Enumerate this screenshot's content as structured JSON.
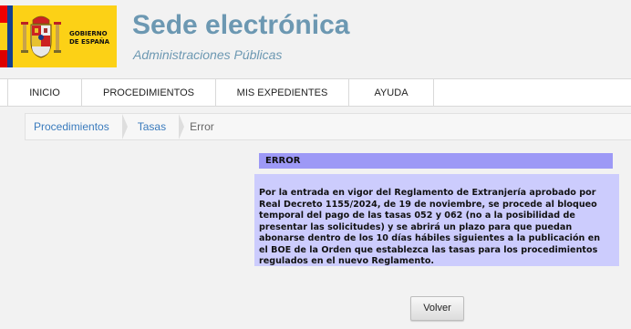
{
  "header": {
    "logo_text_line1": "GOBIERNO",
    "logo_text_line2": "DE ESPAÑA",
    "title": "Sede electrónica",
    "subtitle": "Administraciones Públicas"
  },
  "nav": {
    "items": [
      {
        "label": "INICIO"
      },
      {
        "label": "PROCEDIMIENTOS"
      },
      {
        "label": "MIS EXPEDIENTES"
      },
      {
        "label": "AYUDA"
      }
    ]
  },
  "breadcrumb": {
    "items": [
      {
        "label": "Procedimientos"
      },
      {
        "label": "Tasas"
      },
      {
        "label": "Error"
      }
    ]
  },
  "error": {
    "heading": "ERROR",
    "message": "Por la entrada en vigor del Reglamento de Extranjería aprobado por Real Decreto 1155/2024, de 19 de noviembre, se procede al bloqueo temporal del pago de las tasas 052 y 062 (no a la posibilidad de presentar las solicitudes) y se abrirá un plazo para que puedan abonarse dentro de los 10 días hábiles siguientes a la publicación en el BOE de la Orden que establezca las tasas para los procedimientos regulados en el nuevo Reglamento."
  },
  "actions": {
    "back_label": "Volver"
  },
  "colors": {
    "title": "#6c98b2",
    "link": "#3a7bbd",
    "error_heading_bg": "#9d99f6",
    "error_body_bg": "#ccccfd"
  },
  "icons": {
    "logo": "spain-coat-of-arms-icon"
  }
}
